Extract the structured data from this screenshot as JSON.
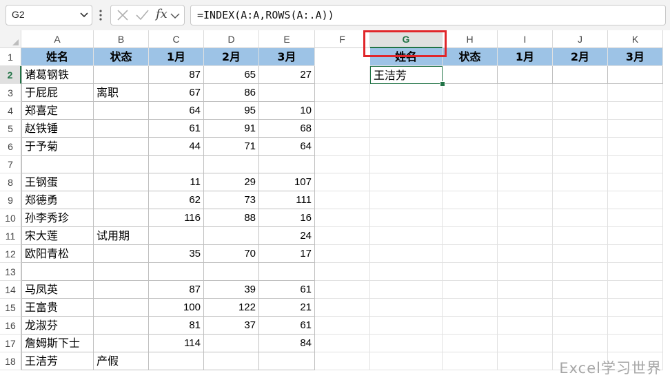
{
  "name_box": {
    "value": "G2"
  },
  "formula_bar": {
    "fx_label": "fx",
    "formula": "=INDEX(A:A,ROWS(A:.A))"
  },
  "columns": [
    "A",
    "B",
    "C",
    "D",
    "E",
    "F",
    "G",
    "H",
    "I",
    "J",
    "K"
  ],
  "selected_column": "G",
  "selected_row": 2,
  "active_cell": {
    "ref": "G2",
    "value": "王洁芳"
  },
  "header_row": [
    "姓名",
    "状态",
    "1月",
    "2月",
    "3月"
  ],
  "output_header": [
    "姓名",
    "状态",
    "1月",
    "2月",
    "3月"
  ],
  "rows": [
    {
      "num": "2",
      "name": "诸葛钢铁",
      "status": "",
      "m1": "87",
      "m2": "65",
      "m3": "27"
    },
    {
      "num": "3",
      "name": "于屁屁",
      "status": "离职",
      "m1": "67",
      "m2": "86",
      "m3": ""
    },
    {
      "num": "4",
      "name": "郑喜定",
      "status": "",
      "m1": "64",
      "m2": "95",
      "m3": "10"
    },
    {
      "num": "5",
      "name": "赵铁锤",
      "status": "",
      "m1": "61",
      "m2": "91",
      "m3": "68"
    },
    {
      "num": "6",
      "name": "于予菊",
      "status": "",
      "m1": "44",
      "m2": "71",
      "m3": "64"
    },
    {
      "num": "7",
      "name": "",
      "status": "",
      "m1": "",
      "m2": "",
      "m3": ""
    },
    {
      "num": "8",
      "name": "王钢蛋",
      "status": "",
      "m1": "11",
      "m2": "29",
      "m3": "107"
    },
    {
      "num": "9",
      "name": "郑德勇",
      "status": "",
      "m1": "62",
      "m2": "73",
      "m3": "111"
    },
    {
      "num": "10",
      "name": "孙李秀珍",
      "status": "",
      "m1": "116",
      "m2": "88",
      "m3": "16"
    },
    {
      "num": "11",
      "name": "宋大莲",
      "status": "试用期",
      "m1": "",
      "m2": "",
      "m3": "24"
    },
    {
      "num": "12",
      "name": "欧阳青松",
      "status": "",
      "m1": "35",
      "m2": "70",
      "m3": "17"
    },
    {
      "num": "13",
      "name": "",
      "status": "",
      "m1": "",
      "m2": "",
      "m3": ""
    },
    {
      "num": "14",
      "name": "马凤英",
      "status": "",
      "m1": "87",
      "m2": "39",
      "m3": "61"
    },
    {
      "num": "15",
      "name": "王富贵",
      "status": "",
      "m1": "100",
      "m2": "122",
      "m3": "21"
    },
    {
      "num": "16",
      "name": "龙淑芬",
      "status": "",
      "m1": "81",
      "m2": "37",
      "m3": "61"
    },
    {
      "num": "17",
      "name": "詹姆斯下士",
      "status": "",
      "m1": "114",
      "m2": "",
      "m3": "84"
    },
    {
      "num": "18",
      "name": "王洁芳",
      "status": "产假",
      "m1": "",
      "m2": "",
      "m3": ""
    }
  ],
  "row_numbers": [
    "1",
    "2",
    "3",
    "4",
    "5",
    "6",
    "7",
    "8",
    "9",
    "10",
    "11",
    "12",
    "13",
    "14",
    "15",
    "16",
    "17",
    "18"
  ],
  "watermark": "Excel学习世界",
  "colors": {
    "header_fill": "#9dc3e6",
    "selection_green": "#217346",
    "highlight_red": "#e0262a"
  }
}
